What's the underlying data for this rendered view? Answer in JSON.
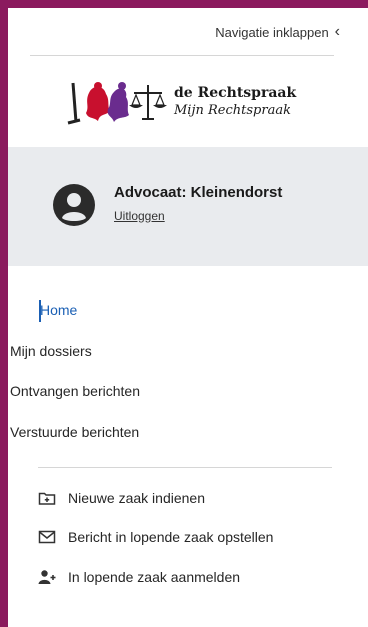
{
  "header": {
    "collapse_label": "Navigatie inklappen"
  },
  "logo": {
    "name": "de Rechtspraak",
    "subtitle": "Mijn Rechtspraak"
  },
  "user": {
    "name": "Advocaat: Kleinendorst",
    "logout_label": "Uitloggen"
  },
  "nav": {
    "items": [
      {
        "label": "Home",
        "active": true
      },
      {
        "label": "Mijn dossiers",
        "active": false
      },
      {
        "label": "Ontvangen berichten",
        "active": false
      },
      {
        "label": "Verstuurde berichten",
        "active": false
      }
    ]
  },
  "actions": [
    {
      "label": "Nieuwe zaak indienen",
      "icon": "folder-plus-icon"
    },
    {
      "label": "Bericht in lopende zaak opstellen",
      "icon": "envelope-icon"
    },
    {
      "label": "In lopende zaak aanmelden",
      "icon": "user-plus-icon"
    }
  ],
  "colors": {
    "frame": "#8b1a5e",
    "accent": "#1a5fb4",
    "panel": "#e9ebee"
  }
}
